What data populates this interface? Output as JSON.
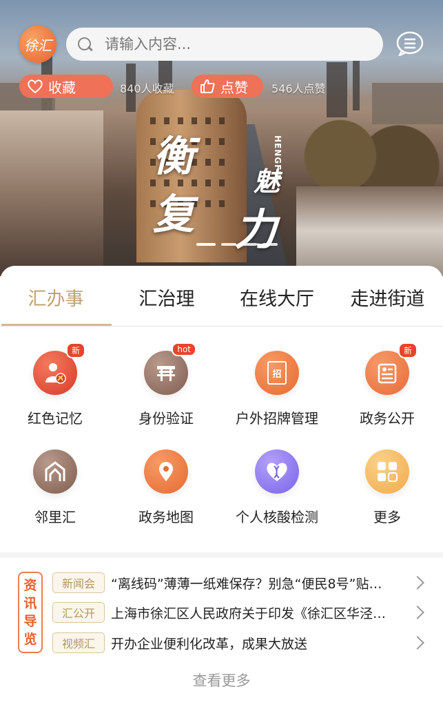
{
  "header": {
    "logo_text": "徐汇",
    "search_placeholder": "请输入内容...",
    "favorite_label": "收藏",
    "favorite_count": "840人收藏",
    "like_label": "点赞",
    "like_count": "546人点赞"
  },
  "banner": {
    "slogan_1": "衡",
    "slogan_2": "复",
    "slogan_3": "魅",
    "slogan_4": "力",
    "street_sign": "HENGFU"
  },
  "tabs": [
    "汇办事",
    "汇治理",
    "在线大厅",
    "走进街道"
  ],
  "services": [
    {
      "label": "红色记忆",
      "badge": "新"
    },
    {
      "label": "身份验证",
      "badge": "hot"
    },
    {
      "label": "户外招牌管理",
      "badge": ""
    },
    {
      "label": "政务公开",
      "badge": "新"
    },
    {
      "label": "邻里汇",
      "badge": ""
    },
    {
      "label": "政务地图",
      "badge": ""
    },
    {
      "label": "个人核酸检测",
      "badge": ""
    },
    {
      "label": "更多",
      "badge": ""
    }
  ],
  "service_icon_glyphs": {
    "sign_board": "招"
  },
  "news": {
    "section_label": [
      "资",
      "讯",
      "导",
      "览"
    ],
    "items": [
      {
        "category": "新闻会",
        "title": "“离线码”薄薄一纸难保存？别急“便民8号”贴…"
      },
      {
        "category": "汇公开",
        "title": "上海市徐汇区人民政府关于印发《徐汇区华泾…"
      },
      {
        "category": "视频汇",
        "title": "开办企业便利化改革，成果大放送"
      }
    ],
    "more_label": "查看更多"
  },
  "colors": {
    "accent_orange": "#ee7158",
    "tab_active": "#c0a26f",
    "badge_red": "#e8432d"
  }
}
